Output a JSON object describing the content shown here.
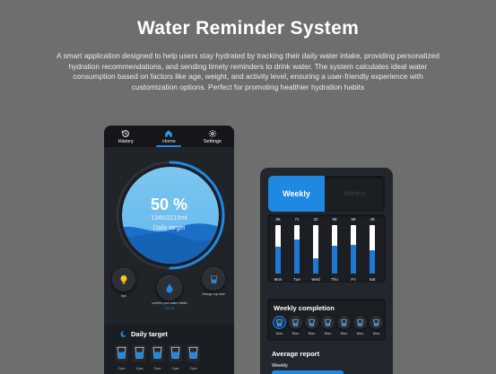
{
  "hero": {
    "title": "Water Reminder System",
    "description": "A smart application designed to help users stay hydrated by tracking their daily water intake, providing personalized hydration recommendations, and sending timely reminders to drink water. The system calculates ideal water consumption based on factors like age, weight, and activity level, ensuring a user-friendly experience with customization options. Perfect for promoting healthier hydration habits"
  },
  "phone1": {
    "nav": [
      {
        "label": "History",
        "icon": "history-icon"
      },
      {
        "label": "Home",
        "icon": "home-icon"
      },
      {
        "label": "Settings",
        "icon": "gear-icon"
      }
    ],
    "active_tab": "Home",
    "progress": {
      "percent_label": "50 %",
      "ratio": "1345/2210ml",
      "caption": "Daily target",
      "fraction": 0.5
    },
    "tips_label": "tips",
    "confirm_label": "confirm your water intake",
    "confirm_amount": "220 ML",
    "change_cup_label": "change cup size",
    "daily_target_title": "Daily target",
    "cups": [
      {
        "time": "2 pm"
      },
      {
        "time": "2 pm"
      },
      {
        "time": "2 pm"
      },
      {
        "time": "2 pm"
      },
      {
        "time": "2 pm"
      }
    ]
  },
  "phone2": {
    "tab_weekly": "Weekly",
    "tab_monthly": "Monthly",
    "weekly_chart": {
      "days": [
        "Mon",
        "Tue",
        "Wed",
        "Thu",
        "Fri",
        "Sat"
      ],
      "values": [
        55,
        71,
        32,
        58,
        59,
        49
      ]
    },
    "completion_title": "Weekly completion",
    "completion_days": [
      "Mon",
      "Mon",
      "Mon",
      "Mon",
      "Mon",
      "Mon",
      "Mon"
    ],
    "average_title": "Average report",
    "average_sub": "Weekly"
  },
  "colors": {
    "accent": "#1e88e5",
    "background": "#6e6e6e",
    "phone": "#202328"
  }
}
